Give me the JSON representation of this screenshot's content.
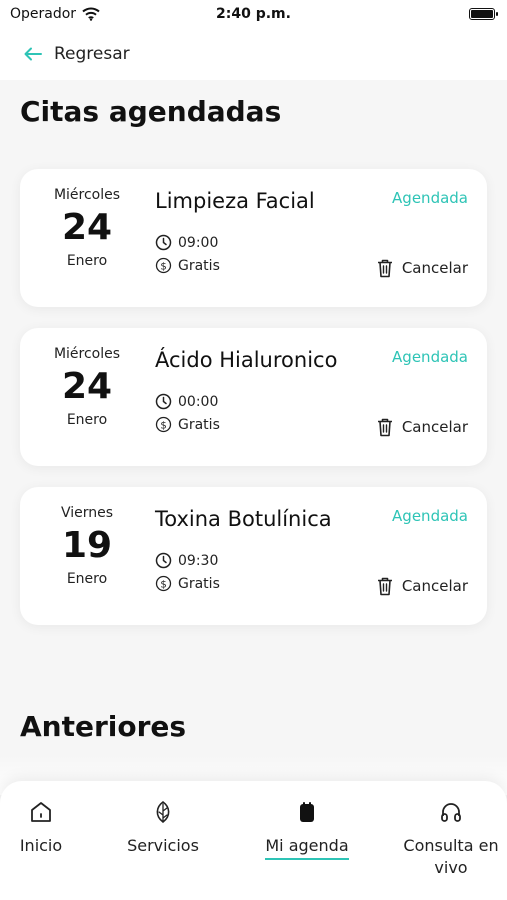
{
  "status_bar": {
    "carrier": "Operador",
    "time": "2:40 p.m."
  },
  "header": {
    "back_label": "Regresar",
    "back_icon": "arrow-left-icon"
  },
  "sections": {
    "upcoming_title": "Citas agendadas",
    "past_title": "Anteriores"
  },
  "appointments": [
    {
      "weekday": "Miércoles",
      "day": "24",
      "month": "Enero",
      "service": "Limpieza Facial",
      "status": "Agendada",
      "time": "09:00",
      "price": "Gratis",
      "cancel_label": "Cancelar"
    },
    {
      "weekday": "Miércoles",
      "day": "24",
      "month": "Enero",
      "service": "Ácido Hialuronico",
      "status": "Agendada",
      "time": "00:00",
      "price": "Gratis",
      "cancel_label": "Cancelar"
    },
    {
      "weekday": "Viernes",
      "day": "19",
      "month": "Enero",
      "service": "Toxina Botulínica",
      "status": "Agendada",
      "time": "09:30",
      "price": "Gratis",
      "cancel_label": "Cancelar"
    }
  ],
  "tab_bar": {
    "tabs": [
      {
        "label": "Inicio",
        "icon": "home-icon"
      },
      {
        "label": "Servicios",
        "icon": "leaf-icon"
      },
      {
        "label": "Mi agenda",
        "icon": "agenda-icon",
        "active": true
      },
      {
        "label": "Consulta en vivo",
        "icon": "headphones-icon"
      }
    ]
  },
  "colors": {
    "accent": "#2ec4b6",
    "background": "#f6f6f6",
    "card": "#ffffff",
    "text": "#111111"
  }
}
